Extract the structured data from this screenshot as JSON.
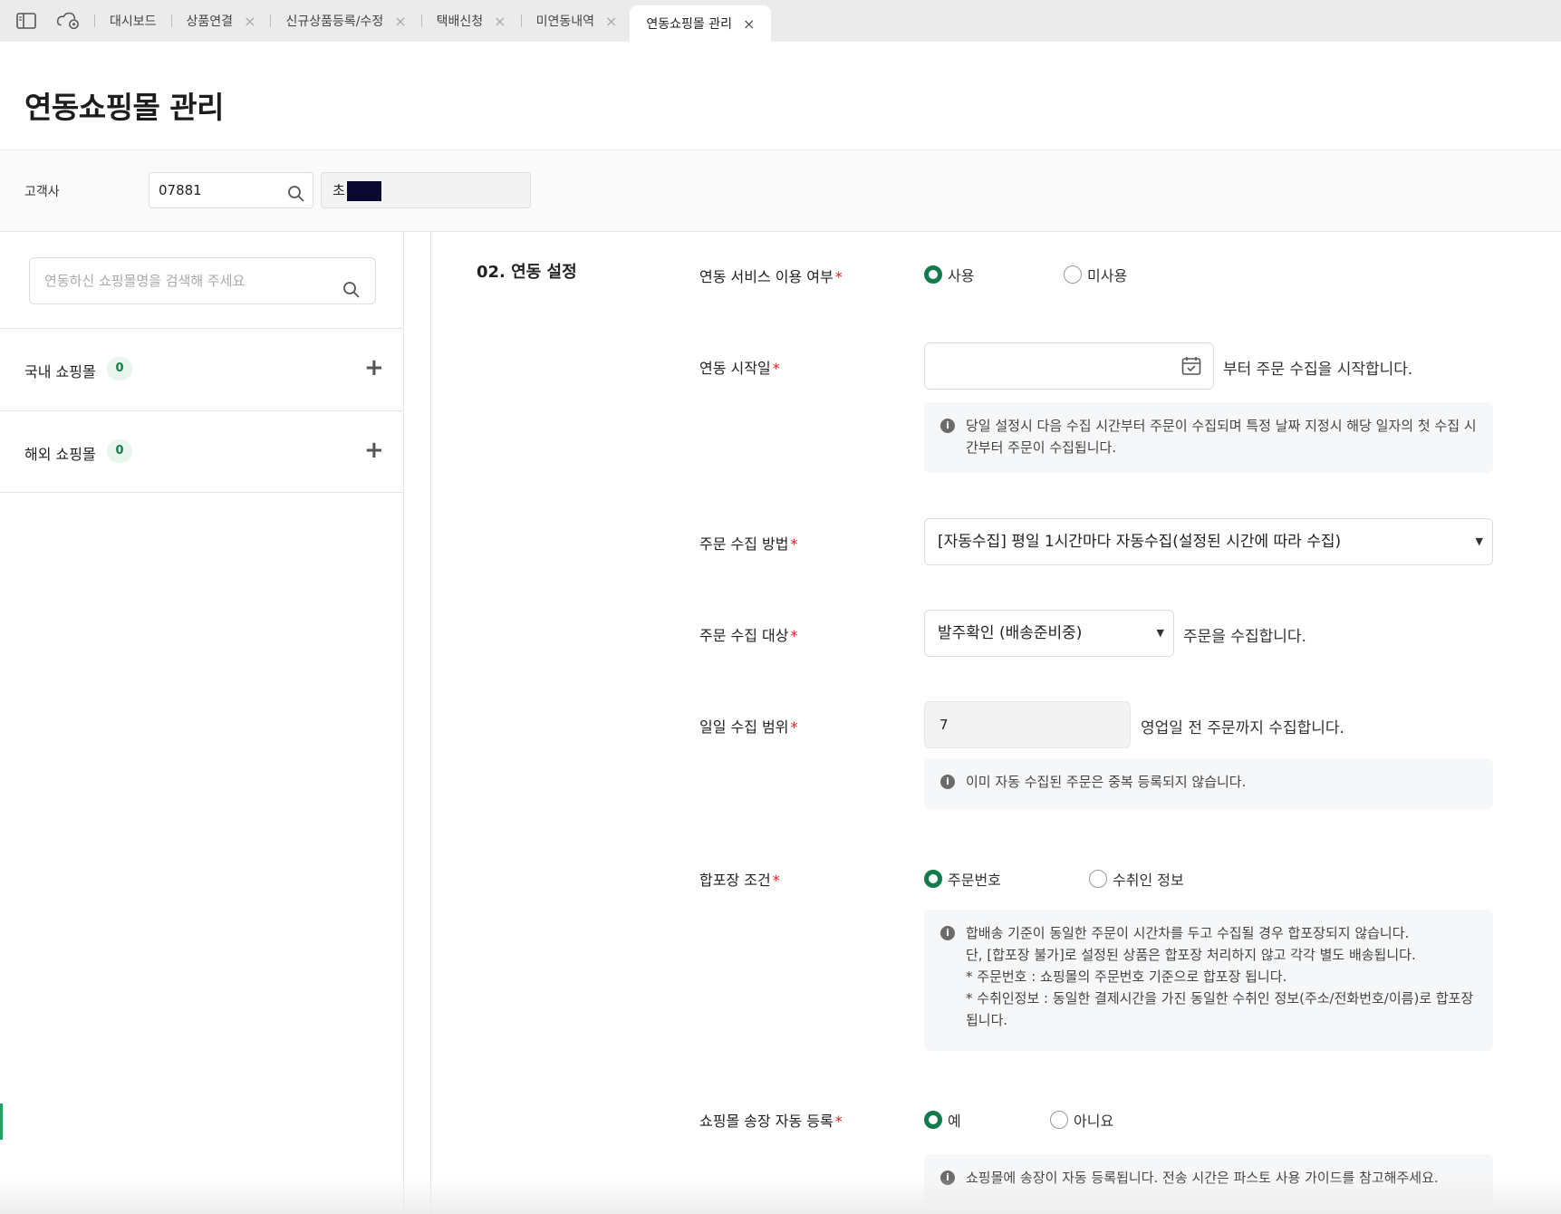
{
  "tabs": [
    {
      "label": "대시보드",
      "closable": false
    },
    {
      "label": "상품연결",
      "closable": true
    },
    {
      "label": "신규상품등록/수정",
      "closable": true
    },
    {
      "label": "택배신청",
      "closable": true
    },
    {
      "label": "미연동내역",
      "closable": true
    },
    {
      "label": "연동쇼핑몰 관리",
      "closable": true,
      "active": true
    }
  ],
  "page": {
    "title": "연동쇼핑몰 관리"
  },
  "customer": {
    "label": "고객사",
    "code": "07881",
    "name_prefix": "초"
  },
  "left_panel": {
    "search_placeholder": "연동하신 쇼핑몰명을 검색해 주세요",
    "groups": [
      {
        "label": "국내 쇼핑몰",
        "count": "0"
      },
      {
        "label": "해외 쇼핑몰",
        "count": "0"
      }
    ]
  },
  "settings": {
    "section_title": "02. 연동 설정",
    "service_use": {
      "label": "연동 서비스 이용 여부",
      "options": [
        "사용",
        "미사용"
      ],
      "selected": "사용"
    },
    "start_date": {
      "label": "연동 시작일",
      "value": "",
      "suffix": "부터 주문 수집을 시작합니다.",
      "info": "당일 설정시 다음 수집 시간부터 주문이 수집되며 특정 날짜 지정시 해당 일자의 첫 수집 시간부터 주문이 수집됩니다."
    },
    "collect_method": {
      "label": "주문 수집 방법",
      "value": "[자동수집] 평일 1시간마다 자동수집(설정된 시간에 따라 수집)"
    },
    "collect_target": {
      "label": "주문 수집 대상",
      "value": "발주확인 (배송준비중)",
      "suffix": "주문을 수집합니다."
    },
    "daily_range": {
      "label": "일일 수집 범위",
      "value": "7",
      "suffix": "영업일 전 주문까지 수집합니다.",
      "info": "이미 자동 수집된 주문은 중복 등록되지 않습니다."
    },
    "combine": {
      "label": "합포장 조건",
      "options": [
        "주문번호",
        "수취인 정보"
      ],
      "selected": "주문번호",
      "info_lines": [
        "합배송 기준이 동일한 주문이 시간차를 두고 수집될 경우 합포장되지 않습니다.",
        "단, [합포장 불가]로 설정된 상품은 합포장 처리하지 않고 각각 별도 배송됩니다.",
        "* 주문번호 : 쇼핑몰의 주문번호 기준으로 합포장 됩니다.",
        "* 수취인정보 : 동일한 결제시간을 가진 동일한 수취인 정보(주소/전화번호/이름)로 합포장됩니다."
      ]
    },
    "invoice_auto": {
      "label": "쇼핑몰 송장 자동 등록",
      "options": [
        "예",
        "아니요"
      ],
      "selected": "예",
      "info": "쇼핑몰에 송장이 자동 등록됩니다. 전송 시간은 파스토 사용 가이드를 참고해주세요."
    }
  },
  "colors": {
    "accent": "#137a4b",
    "required": "#e02020",
    "badge_bg": "#e8f6ee"
  },
  "icons": [
    "sidebar-toggle-icon",
    "cloud-settings-icon",
    "close-icon",
    "search-icon",
    "plus-icon",
    "calendar-icon",
    "info-icon",
    "caret-down-icon"
  ]
}
